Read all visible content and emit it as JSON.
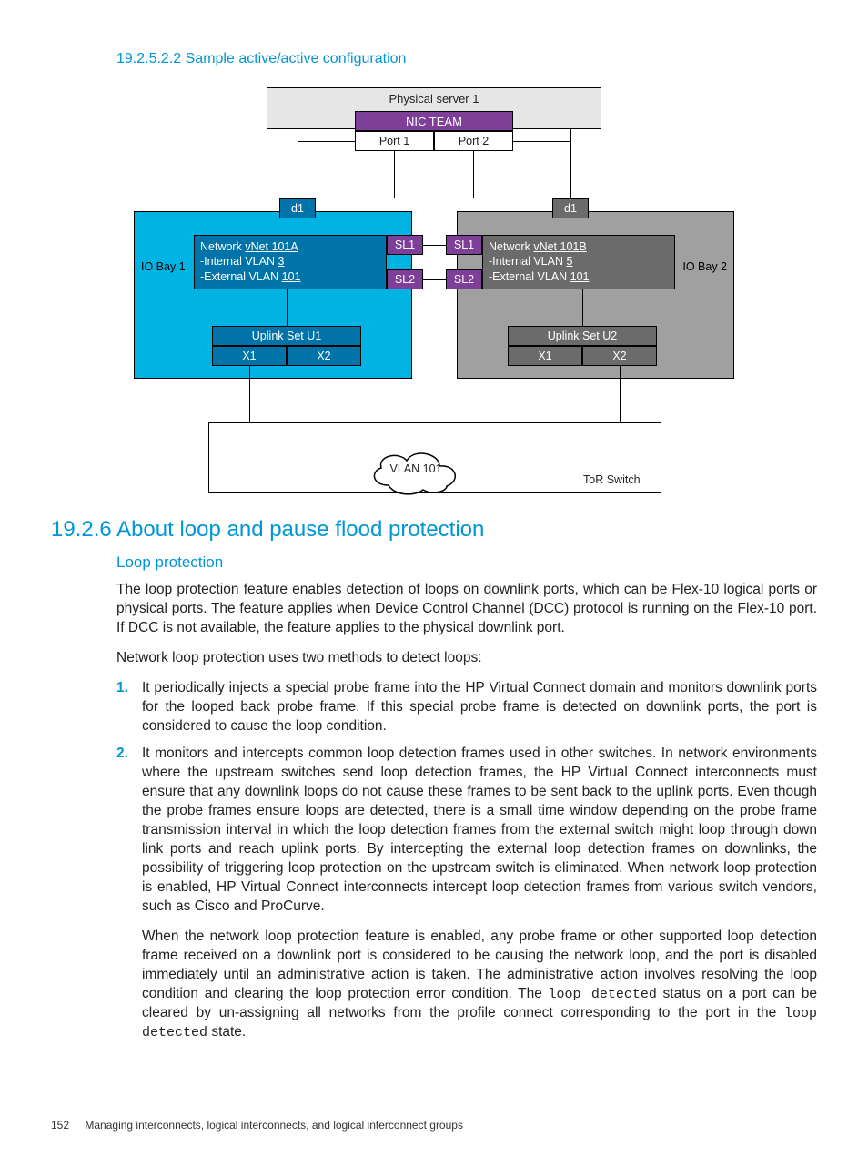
{
  "headings": {
    "h4": "19.2.5.2.2 Sample active/active configuration",
    "h2": "19.2.6 About loop and pause flood protection",
    "h3": "Loop protection"
  },
  "diagram": {
    "physical_server": "Physical server 1",
    "nic_team": "NIC TEAM",
    "port1": "Port 1",
    "port2": "Port 2",
    "d1_left": "d1",
    "d1_right": "d1",
    "io_bay1": "IO Bay 1",
    "io_bay2": "IO Bay 2",
    "net_a_title": "Network ",
    "net_a_name": "vNet 101A",
    "net_a_internal": "-Internal VLAN ",
    "net_a_internal_u": "3",
    "net_a_external": "-External VLAN ",
    "net_a_external_u": "101",
    "net_b_title": "Network ",
    "net_b_name": "vNet 101B",
    "net_b_internal": "-Internal VLAN ",
    "net_b_internal_u": "5",
    "net_b_external": "-External VLAN ",
    "net_b_external_u": "101",
    "sl1": "SL1",
    "sl2": "SL2",
    "uplink_u1": "Uplink Set U1",
    "uplink_u2": "Uplink Set U2",
    "x1": "X1",
    "x2": "X2",
    "vlan101": "VLAN 101",
    "tor": "ToR Switch"
  },
  "body": {
    "p1": "The loop protection feature enables detection of loops on downlink ports, which can be Flex-10 logical ports or physical ports. The feature applies when Device Control Channel (DCC) protocol is running on the Flex-10 port. If DCC is not available, the feature applies to the physical downlink port.",
    "p2": "Network loop protection uses two methods to detect loops:",
    "li1": "It periodically injects a special probe frame into the HP Virtual Connect domain and monitors downlink ports for the looped back probe frame. If this special probe frame is detected on downlink ports, the port is considered to cause the loop condition.",
    "li2a": "It monitors and intercepts common loop detection frames used in other switches. In network environments where the upstream switches send loop detection frames, the HP Virtual Connect interconnects must ensure that any downlink loops do not cause these frames to be sent back to the uplink ports. Even though the probe frames ensure loops are detected, there is a small time window depending on the probe frame transmission interval in which the loop detection frames from the external switch might loop through down link ports and reach uplink ports. By intercepting the external loop detection frames on downlinks, the possibility of triggering loop protection on the upstream switch is eliminated. When network loop protection is enabled, HP Virtual Connect interconnects intercept loop detection frames from various switch vendors, such as Cisco and ProCurve.",
    "li2b_pre": "When the network loop protection feature is enabled, any probe frame or other supported loop detection frame received on a downlink port is considered to be causing the network loop, and the port is disabled immediately until an administrative action is taken. The administrative action involves resolving the loop condition and clearing the loop protection error condition. The ",
    "li2b_code1": "loop detected",
    "li2b_mid": " status on a port can be cleared by un-assigning all networks from the profile connect corresponding to the port in the ",
    "li2b_code2": "loop detected",
    "li2b_post": " state."
  },
  "footer": {
    "page": "152",
    "chapter": "Managing interconnects, logical interconnects, and logical interconnect groups"
  }
}
